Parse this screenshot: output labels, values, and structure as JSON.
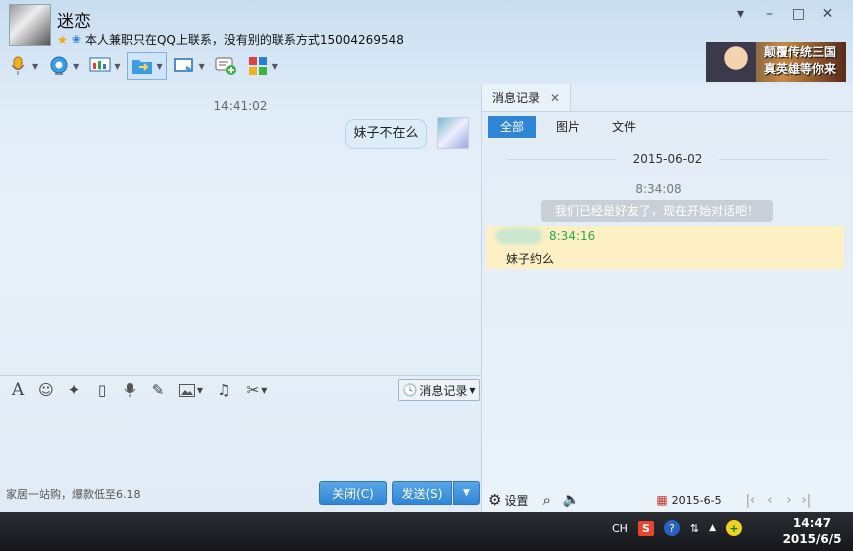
{
  "contact": {
    "name": "迷恋",
    "signature": "本人兼职只在QQ上联系，没有别的联系方式15004269548"
  },
  "ad": {
    "line1": "颠覆传统三国",
    "line2": "真英雄等你来"
  },
  "chat": {
    "time": "14:41:02",
    "message": "妹子不在么"
  },
  "editor": {
    "history_label": "消息记录"
  },
  "promo": "家居一站购，爆款低至6.18",
  "buttons": {
    "close": "关闭(C)",
    "send": "发送(S)"
  },
  "history": {
    "tab_label": "消息记录",
    "filters": [
      "全部",
      "图片",
      "文件"
    ],
    "date": "2015-06-02",
    "system_time": "8:34:08",
    "system_message": "我们已经是好友了，现在开始对话吧！",
    "entry_time": "8:34:16",
    "entry_message": "妹子约么",
    "settings_label": "设置",
    "footer_date": "2015-6-5"
  },
  "taskbar": {
    "lang": "CH",
    "time": "14:47",
    "date": "2015/6/5"
  }
}
